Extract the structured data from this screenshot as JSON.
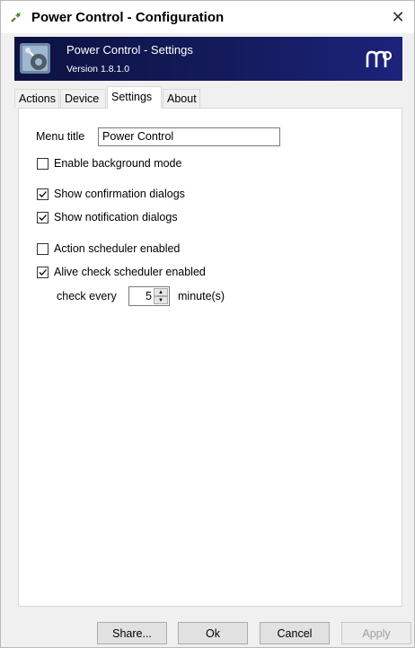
{
  "window": {
    "title": "Power Control - Configuration",
    "close_glyph": "✕"
  },
  "banner": {
    "title": "Power Control - Settings",
    "version": "Version 1.8.1.0"
  },
  "tabs": [
    {
      "label": "Actions",
      "active": false
    },
    {
      "label": "Device",
      "active": false
    },
    {
      "label": "Settings",
      "active": true
    },
    {
      "label": "About",
      "active": false
    }
  ],
  "settings": {
    "menu_title_label": "Menu title",
    "menu_title_value": "Power Control",
    "checkboxes": [
      {
        "label": "Enable background mode",
        "checked": false
      },
      {
        "label": "Show confirmation dialogs",
        "checked": true
      },
      {
        "label": "Show notification dialogs",
        "checked": true
      },
      {
        "label": "Action scheduler enabled",
        "checked": false
      },
      {
        "label": "Alive check scheduler enabled",
        "checked": true
      }
    ],
    "check_every_label": "check every",
    "check_every_value": "5",
    "minutes_label": "minute(s)"
  },
  "buttons": {
    "share": "Share...",
    "ok": "Ok",
    "cancel": "Cancel",
    "apply": "Apply"
  },
  "colors": {
    "banner_dark": "#0d1240",
    "banner_light": "#1c237a"
  }
}
